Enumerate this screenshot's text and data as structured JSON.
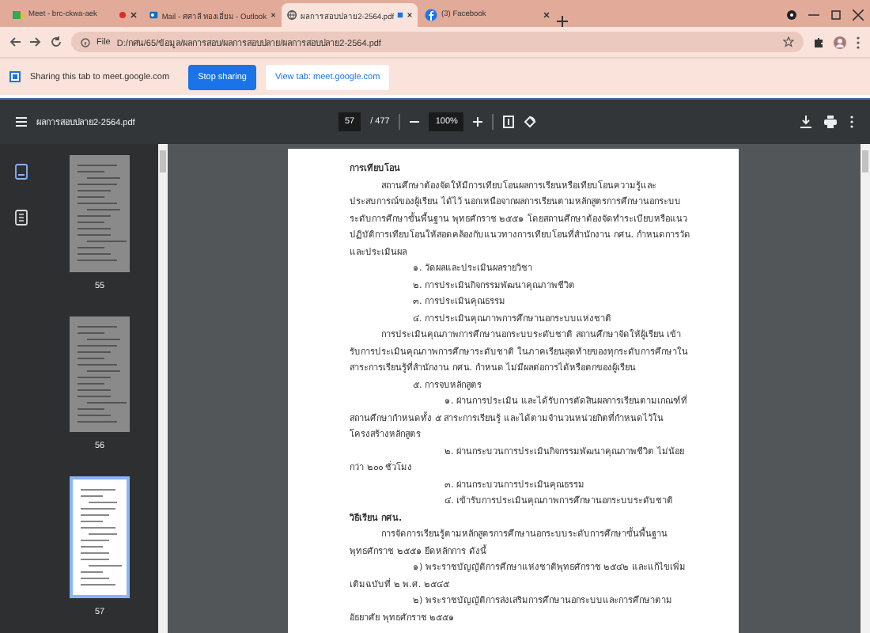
{
  "tabs": [
    {
      "title": "Meet - brc-ckwa-aek",
      "kind": "meet",
      "recording": true,
      "sharing": false,
      "selected": false
    },
    {
      "title": "Mail - ศศาลี ทองเอี่ยม - Outlook",
      "kind": "outlook",
      "recording": false,
      "sharing": false,
      "selected": false
    },
    {
      "title": "ผลการสอบปลาย2-2564.pdf",
      "kind": "globe",
      "recording": false,
      "sharing": true,
      "selected": true
    },
    {
      "title": "(3) Facebook",
      "kind": "facebook",
      "recording": false,
      "sharing": false,
      "selected": false
    }
  ],
  "address_bar": {
    "scheme": "File",
    "path": "D:/กศน/65/ข้อมูล/ผลการสอบ/ผลการสอบปลาย/ผลการสอบปลาย2-2564.pdf"
  },
  "sharing_bar": {
    "message": "Sharing this tab to meet.google.com",
    "stop_button": "Stop sharing",
    "view_button": "View tab: meet.google.com"
  },
  "pdf_toolbar": {
    "title": "ผลการสอบปลาย2-2564.pdf",
    "page": "57",
    "page_count": "/ 477",
    "zoom": "100%"
  },
  "sidebar": {
    "views": [
      {
        "kind": "thumbnails",
        "selected": true
      },
      {
        "kind": "outline",
        "selected": false
      }
    ],
    "thumbnails": [
      {
        "label": "55",
        "selected": false
      },
      {
        "label": "56",
        "selected": false
      },
      {
        "label": "57",
        "selected": true
      }
    ]
  },
  "document": {
    "blocks": [
      {
        "kind": "heading",
        "text": "การเทียบโอน"
      },
      {
        "kind": "paragraph",
        "text": "สถานศึกษาต้องจัดให้มีการเทียบโอนผลการเรียนหรือเทียบโอนความรู้และประสบการณ์ของผู้เรียน ได้ไว้ นอกเหนือจากผลการเรียนตามหลักสูตรการศึกษานอกระบบระดับการศึกษาขั้นพื้นฐาน พุทธศักราช ๒๕๕๑ โดยสถานศึกษาต้องจัดทำระเบียบหรือแนวปฏิบัติการเทียบโอนให้สอดคล้องกับแนวทางการเทียบโอนที่สำนักงาน กศน. กำหนดการวัดและประเมินผล"
      },
      {
        "kind": "item",
        "text": "๑. วัดผลและประเมินผลรายวิชา"
      },
      {
        "kind": "item",
        "text": "๒. การประเมินกิจกรรมพัฒนาคุณภาพชีวิต"
      },
      {
        "kind": "item",
        "text": "๓. การประเมินคุณธรรม"
      },
      {
        "kind": "item",
        "text": "๔. การประเมินคุณภาพการศึกษานอกระบบแห่งชาติ"
      },
      {
        "kind": "paragraph",
        "text": "การประเมินคุณภาพการศึกษานอกระบบระดับชาติ สถานศึกษาจัดให้ผู้เรียน เข้ารับการประเมินคุณภาพการศึกษาระดับชาติ ในภาคเรียนสุดท้ายของทุกระดับการศึกษาในสาระการเรียนรู้ที่สำนักงาน กศน. กำหนด ไม่มีผลต่อการได้หรือตกของผู้เรียน"
      },
      {
        "kind": "item",
        "text": "๕. การจบหลักสูตร",
        "children": [
          {
            "kind": "item",
            "text": "๑. ผ่านการประเมิน และได้รับการตัดสินผลการเรียนตามเกณฑ์ที่สถานศึกษากำหนดทั้ง ๕ สาระการเรียนรู้ และได้ตามจำนวนหน่วยกิตที่กำหนดไว้ในโครงสร้างหลักสูตร"
          },
          {
            "kind": "item",
            "text": "๒. ผ่านกระบวนการประเมินกิจกรรมพัฒนาคุณภาพชีวิต ไม่น้อยกว่า ๒๐๐ ชั่วโมง"
          },
          {
            "kind": "item",
            "text": "๓. ผ่านกระบวนการประเมินคุณธรรม"
          },
          {
            "kind": "item",
            "text": "๔. เข้ารับการประเมินคุณภาพการศึกษานอกระบบระดับชาติ"
          }
        ]
      },
      {
        "kind": "heading",
        "text": "วิธีเรียน กศน."
      },
      {
        "kind": "paragraph",
        "text": "การจัดการเรียนรู้ตามหลักสูตรการศึกษานอกระบบระดับการศึกษาขั้นพื้นฐาน พุทธศักราช ๒๕๕๑ ยึดหลักการ ดังนี้"
      },
      {
        "kind": "item",
        "text": "๑) พระราชบัญญัติการศึกษาแห่งชาติพุทธศักราช ๒๕๔๒ และแก้ไขเพิ่มเติมฉบับที่ ๒ พ.ศ. ๒๕๔๕"
      },
      {
        "kind": "item",
        "text": "๒) พระราชบัญญัติการส่งเสริมการศึกษานอกระบบและการศึกษาตามอัธยาศัย พุทธศักราช ๒๕๕๑"
      }
    ]
  }
}
